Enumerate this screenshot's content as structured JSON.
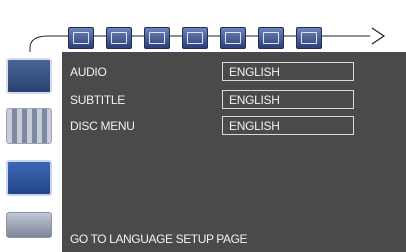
{
  "top_menu": {
    "icons": [
      "general-setup-icon",
      "speaker-setup-icon",
      "audio-setup-icon",
      "video-setup-icon",
      "preference-icon",
      "password-icon",
      "exit-setup-icon"
    ]
  },
  "sidebar": {
    "items": [
      "tv-display-icon",
      "language-icon",
      "video-output-icon",
      "misc-setup-icon"
    ]
  },
  "language_settings": [
    {
      "label": "AUDIO",
      "value": "ENGLISH"
    },
    {
      "label": "SUBTITLE",
      "value": "ENGLISH"
    },
    {
      "label": "DISC MENU",
      "value": "ENGLISH"
    }
  ],
  "hint": "GO TO LANGUAGE SETUP PAGE",
  "colors": {
    "panel": "#4a4a4a",
    "text": "#f2f2f2",
    "field_border": "#d9d9d9",
    "icon_blue": "#2b3f78"
  }
}
